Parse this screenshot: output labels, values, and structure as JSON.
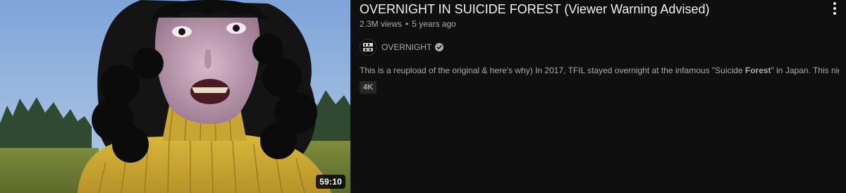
{
  "video": {
    "title": "OVERNIGHT IN SUICIDE FOREST (Viewer Warning Advised)",
    "views": "2.3M views",
    "separator": "•",
    "age": "5 years ago",
    "duration": "59:10",
    "channel": {
      "name": "OVERNIGHT",
      "avatar_text": "OVER NIGHT",
      "verified_icon": "verified-check-icon"
    },
    "snippet": {
      "before": "This is a reupload of the original & here's why) In 2017, TFIL stayed overnight at the infamous \"Suicide ",
      "highlight": "Forest",
      "after": "\" in Japan. This night ..."
    },
    "badge": "4K",
    "menu_icon": "more-vertical-icon"
  },
  "colors": {
    "background": "#0f0f0f",
    "title": "#f1f1f1",
    "secondary_text": "#aaaaaa",
    "badge_bg": "#272727"
  }
}
